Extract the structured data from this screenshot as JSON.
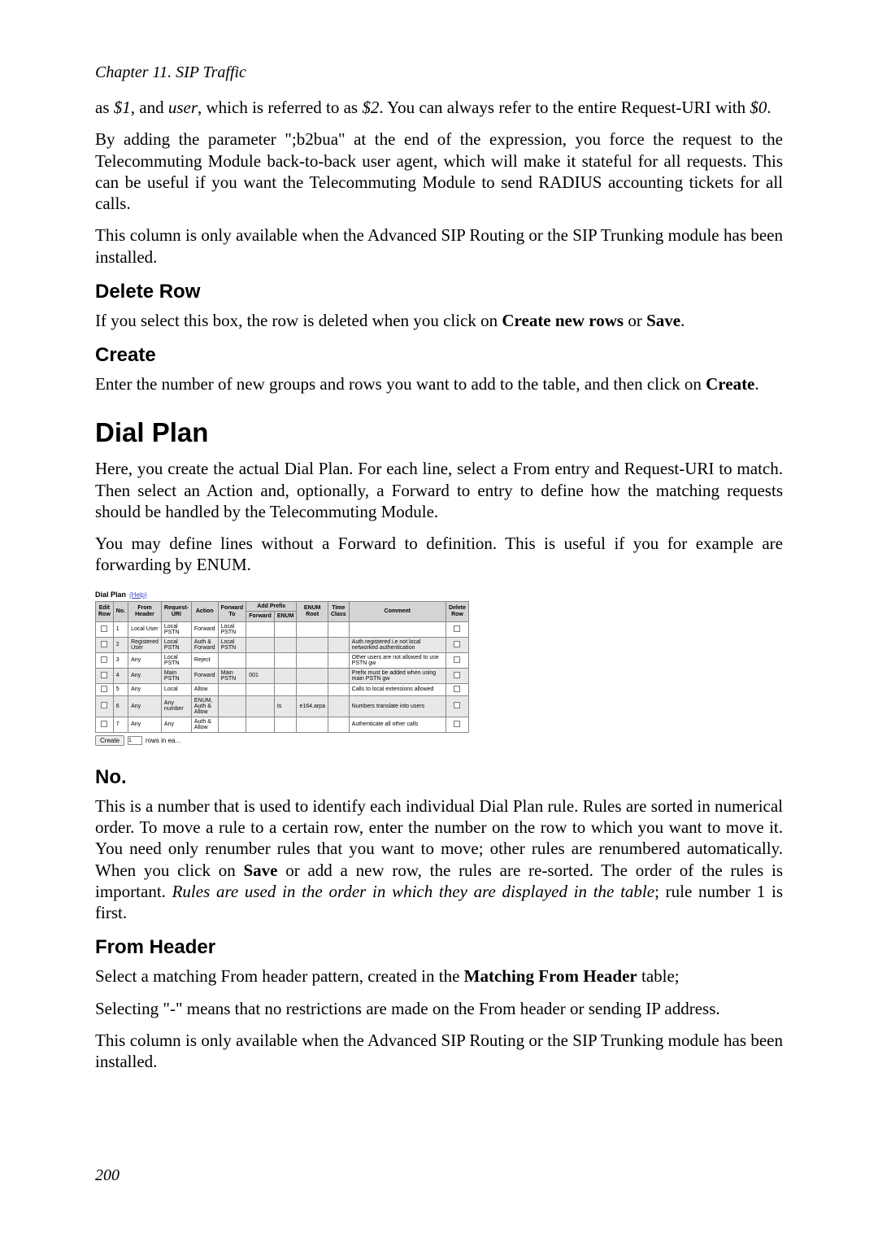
{
  "chapter_header": "Chapter 11. SIP Traffic",
  "intro_text_1": "as ",
  "var1": "$1",
  "intro_text_2": ", and ",
  "var_user": "user",
  "intro_text_3": ", which is referred to as ",
  "var2": "$2",
  "intro_text_4": ". You can always refer to the entire Request-URI with ",
  "var0": "$0",
  "intro_text_5": ".",
  "para_b2bua": "By adding the parameter \";b2bua\" at the end of the expression, you force the request to the Telecommuting Module back-to-back user agent, which will make it stateful for all requests. This can be useful if you want the Telecommuting Module to send RADIUS accounting tickets for all calls.",
  "para_column_avail": "This column is only available when the Advanced SIP Routing or the SIP Trunking module has been installed.",
  "h3_delete": "Delete Row",
  "para_delete_1": "If you select this box, the row is deleted when you click on ",
  "para_delete_bold1": "Create new rows",
  "para_delete_2": " or ",
  "para_delete_bold2": "Save",
  "para_delete_3": ".",
  "h3_create": "Create",
  "para_create_1": "Enter the number of new groups and rows you want to add to the table, and then click on ",
  "para_create_bold": "Create",
  "para_create_2": ".",
  "h2_dialplan": "Dial Plan",
  "para_dialplan_1": "Here, you create the actual Dial Plan. For each line, select a From entry and Request-URI to match. Then select an Action and, optionally, a Forward to entry to define how the matching requests should be handled by the Telecommuting Module.",
  "para_dialplan_2": "You may define lines without a Forward to definition. This is useful if you for example are forwarding by ENUM.",
  "screenshot": {
    "title": "Dial Plan",
    "help": "(Help)",
    "headers": [
      "Edit Row",
      "No.",
      "From Header",
      "Request-URI",
      "Action",
      "Forward To",
      "Add Prefix",
      "ENUM Root",
      "Time Class",
      "Comment",
      "Delete Row"
    ],
    "subheaders": [
      "",
      "",
      "",
      "",
      "",
      "",
      "Forward",
      "ENUM",
      "",
      "",
      "",
      ""
    ],
    "rows": [
      {
        "no": "1",
        "from": "Local User",
        "ruri": "Local PSTN",
        "action": "Forward",
        "fwd": "Local PSTN",
        "comment": ""
      },
      {
        "no": "2",
        "from": "Registered User",
        "ruri": "Local PSTN",
        "action": "Auth & Forward",
        "fwd": "Local PSTN",
        "comment": "Auth registered i.e not local networked authentication"
      },
      {
        "no": "3",
        "from": "Any",
        "ruri": "Local PSTN",
        "action": "Reject",
        "fwd": "",
        "comment": "Other users are not allowed to use PSTN gw"
      },
      {
        "no": "4",
        "from": "Any",
        "ruri": "Main PSTN",
        "action": "Forward",
        "fwd": "Main PSTN",
        "prefix": "001",
        "comment": "Prefix must be added when using main PSTN gw"
      },
      {
        "no": "5",
        "from": "Any",
        "ruri": "Local",
        "action": "Allow",
        "fwd": "",
        "comment": "Calls to local extensions allowed"
      },
      {
        "no": "6",
        "from": "Any",
        "ruri": "Any number",
        "action": "ENUM, Auth & Allow",
        "fwd": "",
        "enum": "Is",
        "root": "e164.arpa",
        "comment": "Numbers translate into users"
      },
      {
        "no": "7",
        "from": "Any",
        "ruri": "Any",
        "action": "Auth & Allow",
        "fwd": "",
        "comment": "Authenticate all other calls"
      }
    ],
    "create_label": "Create",
    "create_value": "1",
    "rows_label": "rows in ea..."
  },
  "h3_no": "No.",
  "para_no_1": "This is a number that is used to identify each individual Dial Plan rule. Rules are sorted in numerical order. To move a rule to a certain row, enter the number on the row to which you want to move it. You need only renumber rules that you want to move; other rules are renumbered automatically. When you click on ",
  "para_no_bold": "Save",
  "para_no_2": " or add a new row, the rules are re-sorted. The order of the rules is important. ",
  "para_no_italic": "Rules are used in the order in which they are displayed in the table",
  "para_no_3": "; rule number 1 is first.",
  "h3_from": "From Header",
  "para_from_1": "Select a matching From header pattern, created in the ",
  "para_from_bold": "Matching From Header",
  "para_from_2": " table;",
  "para_from_3": "Selecting \"-\" means that no restrictions are made on the From header or sending IP address.",
  "para_from_4": "This column is only available when the Advanced SIP Routing or the SIP Trunking module has been installed.",
  "page_number": "200"
}
